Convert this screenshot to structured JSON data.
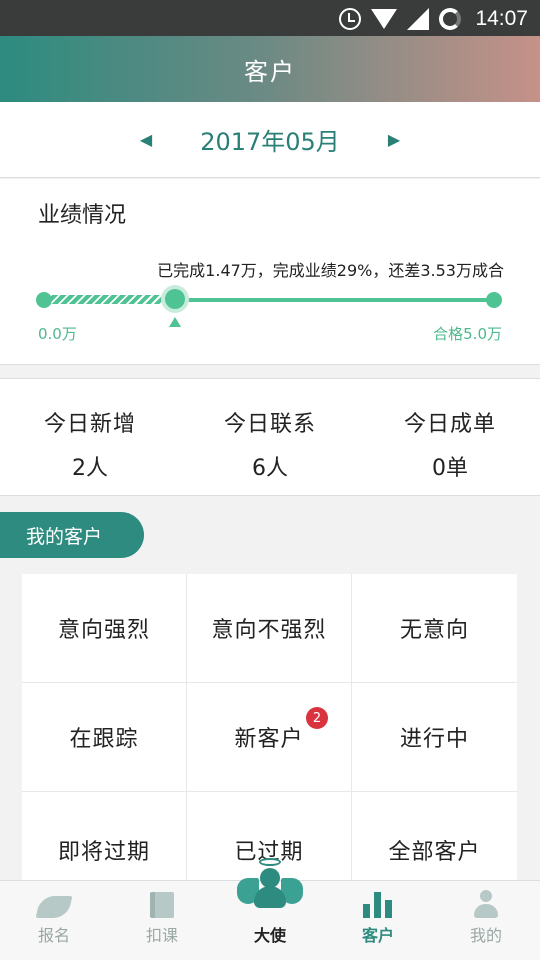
{
  "status_bar": {
    "time": "14:07",
    "icons": [
      "alarm-icon",
      "wifi-icon",
      "signal-icon",
      "sync-icon"
    ]
  },
  "header": {
    "title": "客户"
  },
  "month_selector": {
    "prev": "◀",
    "month": "2017年05月",
    "next": "▶"
  },
  "performance": {
    "title": "业绩情况",
    "summary": "已完成1.47万，完成业绩29%，还差3.53万成合",
    "progress_fraction": 0.29,
    "min_label": "0.0万",
    "max_label": "合格5.0万"
  },
  "today": [
    {
      "label": "今日新增",
      "value": "2人"
    },
    {
      "label": "今日联系",
      "value": "6人"
    },
    {
      "label": "今日成单",
      "value": "0单"
    }
  ],
  "my_customers": {
    "section_label": "我的客户",
    "items": [
      {
        "label": "意向强烈"
      },
      {
        "label": "意向不强烈"
      },
      {
        "label": "无意向"
      },
      {
        "label": "在跟踪"
      },
      {
        "label": "新客户",
        "badge": "2"
      },
      {
        "label": "进行中"
      },
      {
        "label": "即将过期"
      },
      {
        "label": "已过期"
      },
      {
        "label": "全部客户"
      }
    ]
  },
  "bottom_nav": [
    {
      "label": "报名",
      "icon": "feather-icon"
    },
    {
      "label": "扣课",
      "icon": "book-icon"
    },
    {
      "label": "大使",
      "icon": "angel-icon"
    },
    {
      "label": "客户",
      "icon": "bar-chart-icon",
      "active": true
    },
    {
      "label": "我的",
      "icon": "person-icon"
    }
  ],
  "colors": {
    "primary": "#2d8b7f",
    "progress": "#4fc394",
    "badge": "#d9333f"
  }
}
